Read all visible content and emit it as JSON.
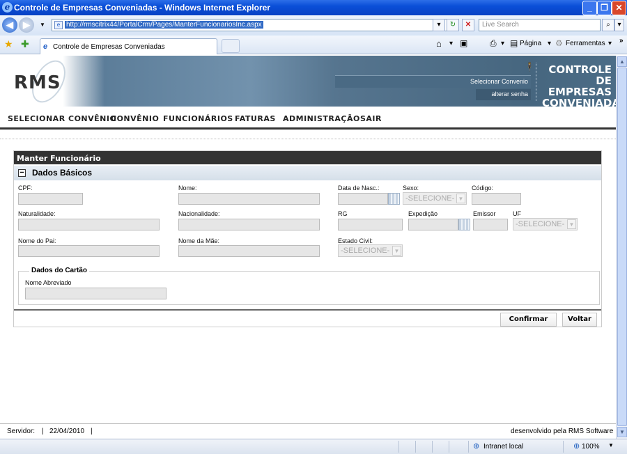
{
  "window": {
    "title": "Controle de Empresas Conveniadas - Windows Internet Explorer"
  },
  "browser": {
    "url": "http://rmscitrix44/PortalCrm/Pages/ManterFuncionariosInc.aspx",
    "search_placeholder": "Live Search",
    "tab_title": "Controle de Empresas Conveniadas",
    "tools": {
      "pagina": "Página",
      "ferramentas": "Ferramentas"
    },
    "status_zone": "Intranet local",
    "zoom": "100%"
  },
  "header": {
    "logo": "RMS",
    "selecionar_convenio": "Selecionar Convenio",
    "alterar_senha": "alterar senha",
    "brand_line1": "CONTROLE",
    "brand_line2": "DE EMPRESAS",
    "brand_line3": "CONVENIADAS"
  },
  "menu": [
    "SELECIONAR CONVÊNIO",
    "CONVÊNIO",
    "FUNCIONÁRIOS",
    "FATURAS",
    "ADMINISTRAÇÃO",
    "SAIR"
  ],
  "panel": {
    "title": "Manter Funcionário",
    "section": "Dados Básicos",
    "fields": {
      "cpf": "CPF:",
      "nome": "Nome:",
      "data_nasc": "Data de Nasc.:",
      "sexo": "Sexo:",
      "codigo": "Código:",
      "naturalidade": "Naturalidade:",
      "nacionalidade": "Nacionalidade:",
      "rg": "RG",
      "expedicao": "Expedição",
      "emissor": "Emissor",
      "uf": "UF",
      "nome_pai": "Nome do Pai:",
      "nome_mae": "Nome da Mãe:",
      "estado_civil": "Estado Civil:"
    },
    "select_default": "-SELECIONE-",
    "card": {
      "legend": "Dados do Cartão",
      "nome_abreviado": "Nome Abreviado"
    },
    "buttons": {
      "confirmar": "Confirmar",
      "voltar": "Voltar"
    }
  },
  "footer": {
    "servidor": "Servidor:",
    "sep": "|",
    "date": "22/04/2010",
    "credit": "desenvolvido pela RMS Software"
  }
}
